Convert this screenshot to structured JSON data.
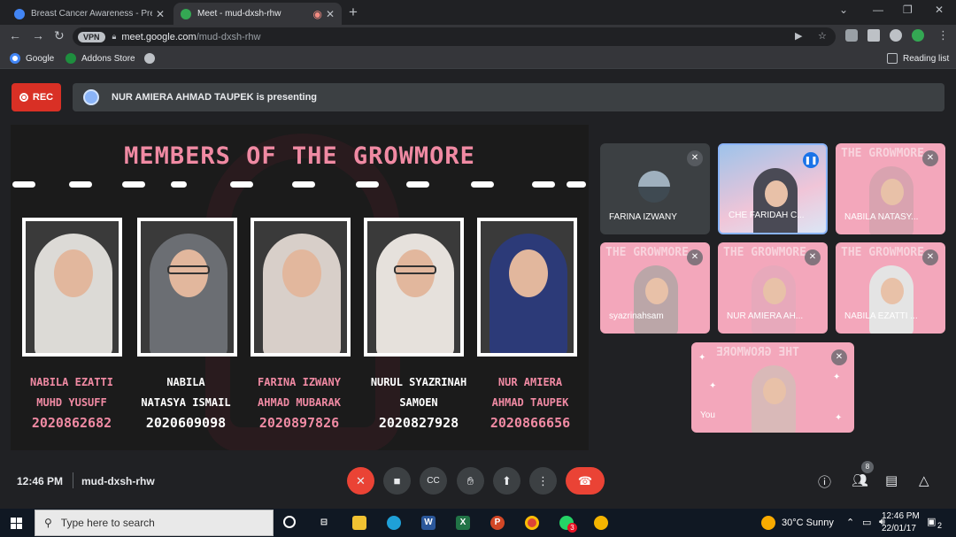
{
  "browser": {
    "tabs": [
      {
        "title": "Breast Cancer Awareness - Prese",
        "fav_color": "#4285f4"
      },
      {
        "title": "Meet - mud-dxsh-rhw",
        "fav_color": "#34a853"
      }
    ],
    "url_domain": "meet.google.com",
    "url_path": "/mud-dxsh-rhw",
    "vpn_label": "VPN",
    "bookmarks": [
      "Google",
      "Addons Store"
    ],
    "reading_list": "Reading list"
  },
  "meet": {
    "rec_label": "REC",
    "presenting_banner": "NUR AMIERA AHMAD TAUPEK is presenting",
    "slide": {
      "title": "MEMBERS OF  THE GROWMORE",
      "members": [
        {
          "line1": "NABILA EZATTI",
          "line2": "MUHD YUSUFF",
          "id": "2020862682",
          "style": "pink"
        },
        {
          "line1": "NABILA",
          "line2": "NATASYA ISMAIL",
          "id": "2020609098",
          "style": "white"
        },
        {
          "line1": "FARINA IZWANY",
          "line2": "AHMAD MUBARAK",
          "id": "2020897826",
          "style": "pink"
        },
        {
          "line1": "NURUL SYAZRINAH",
          "line2": "SAMOEN",
          "id": "2020827928",
          "style": "white"
        },
        {
          "line1": "NUR AMIERA",
          "line2": "AHMAD TAUPEK",
          "id": "2020866656",
          "style": "pink"
        }
      ]
    },
    "participants": [
      {
        "name": "FARINA IZWANY"
      },
      {
        "name": "CHE FARIDAH C..."
      },
      {
        "name": "NABILA NATASY..."
      },
      {
        "name": "syazrinahsam"
      },
      {
        "name": "NUR AMIERA AH..."
      },
      {
        "name": "NABILA EZATTI ..."
      },
      {
        "name": "You"
      }
    ],
    "tile_bg_text": "THE GROWMORE",
    "bottom": {
      "time": "12:46 PM",
      "code": "mud-dxsh-rhw",
      "people_count": "8"
    }
  },
  "taskbar": {
    "search_placeholder": "Type here to search",
    "weather": "30°C  Sunny",
    "clock_time": "12:46 PM",
    "clock_date": "22/01/17",
    "whatsapp_badge": "3",
    "notif_count": "2"
  }
}
